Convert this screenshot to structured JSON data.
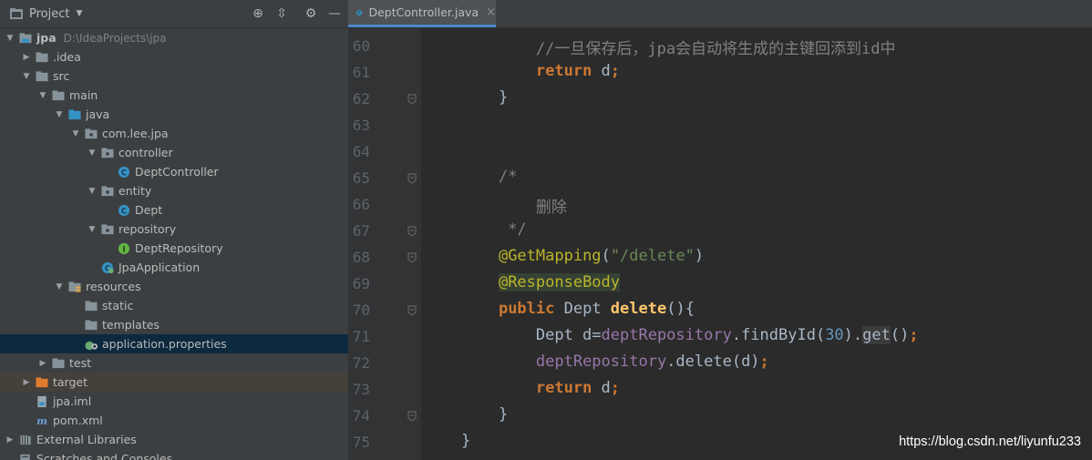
{
  "project_panel": {
    "title": "Project",
    "tree": [
      {
        "label": "jpa",
        "hint": "D:\\IdeaProjects\\jpa",
        "level": 0,
        "arrow": "open",
        "icon": "module-folder-icon",
        "bold": true
      },
      {
        "label": ".idea",
        "level": 1,
        "arrow": "closed",
        "icon": "folder-icon"
      },
      {
        "label": "src",
        "level": 1,
        "arrow": "open",
        "icon": "folder-icon"
      },
      {
        "label": "main",
        "level": 2,
        "arrow": "open",
        "icon": "folder-icon"
      },
      {
        "label": "java",
        "level": 3,
        "arrow": "open",
        "icon": "source-folder-icon"
      },
      {
        "label": "com.lee.jpa",
        "level": 4,
        "arrow": "open",
        "icon": "package-icon"
      },
      {
        "label": "controller",
        "level": 5,
        "arrow": "open",
        "icon": "package-icon"
      },
      {
        "label": "DeptController",
        "level": 6,
        "arrow": "none",
        "icon": "class-icon"
      },
      {
        "label": "entity",
        "level": 5,
        "arrow": "open",
        "icon": "package-icon"
      },
      {
        "label": "Dept",
        "level": 6,
        "arrow": "none",
        "icon": "class-icon"
      },
      {
        "label": "repository",
        "level": 5,
        "arrow": "open",
        "icon": "package-icon"
      },
      {
        "label": "DeptRepository",
        "level": 6,
        "arrow": "none",
        "icon": "interface-icon"
      },
      {
        "label": "JpaApplication",
        "level": 5,
        "arrow": "none",
        "icon": "spring-boot-class-icon"
      },
      {
        "label": "resources",
        "level": 3,
        "arrow": "open",
        "icon": "resources-folder-icon"
      },
      {
        "label": "static",
        "level": 4,
        "arrow": "none",
        "icon": "folder-icon"
      },
      {
        "label": "templates",
        "level": 4,
        "arrow": "none",
        "icon": "folder-icon"
      },
      {
        "label": "application.properties",
        "level": 4,
        "arrow": "none",
        "icon": "spring-properties-icon",
        "selected": true
      },
      {
        "label": "test",
        "level": 2,
        "arrow": "closed",
        "icon": "folder-icon"
      },
      {
        "label": "target",
        "level": 1,
        "arrow": "closed",
        "icon": "excluded-folder-icon",
        "target": true
      },
      {
        "label": "jpa.iml",
        "level": 1,
        "arrow": "none",
        "icon": "iml-file-icon"
      },
      {
        "label": "pom.xml",
        "level": 1,
        "arrow": "none",
        "icon": "maven-icon"
      },
      {
        "label": "External Libraries",
        "level": 0,
        "arrow": "closed",
        "icon": "libraries-icon"
      },
      {
        "label": "Scratches and Consoles",
        "level": 0,
        "arrow": "none",
        "icon": "scratches-icon"
      }
    ]
  },
  "editor": {
    "tab": {
      "label": "DeptController.java",
      "close": "×"
    },
    "lines": [
      {
        "n": "60",
        "tokens": [
          {
            "t": "        //一旦保存后，jpa会自动将生成的主键回添到id中",
            "c": "cm"
          }
        ]
      },
      {
        "n": "61",
        "tokens": [
          {
            "t": "        ",
            "c": ""
          },
          {
            "t": "return",
            "c": "kw"
          },
          {
            "t": " d",
            "c": ""
          },
          {
            "t": ";",
            "c": "kw"
          }
        ]
      },
      {
        "n": "62",
        "fold": true,
        "tokens": [
          {
            "t": "    }",
            "c": ""
          }
        ]
      },
      {
        "n": "63",
        "tokens": []
      },
      {
        "n": "64",
        "tokens": []
      },
      {
        "n": "65",
        "fold": true,
        "tokens": [
          {
            "t": "    /*",
            "c": "cm"
          }
        ]
      },
      {
        "n": "66",
        "tokens": [
          {
            "t": "        删除",
            "c": "cm"
          }
        ]
      },
      {
        "n": "67",
        "fold": true,
        "tokens": [
          {
            "t": "     */",
            "c": "cm"
          }
        ]
      },
      {
        "n": "68",
        "fold": true,
        "tokens": [
          {
            "t": "    ",
            "c": ""
          },
          {
            "t": "@GetMapping",
            "c": "an"
          },
          {
            "t": "(",
            "c": ""
          },
          {
            "t": "\"/delete\"",
            "c": "st"
          },
          {
            "t": ")",
            "c": ""
          }
        ]
      },
      {
        "n": "69",
        "tokens": [
          {
            "t": "    ",
            "c": ""
          },
          {
            "t": "@ResponseBody",
            "c": "an hl"
          }
        ]
      },
      {
        "n": "70",
        "fold": true,
        "tokens": [
          {
            "t": "    ",
            "c": ""
          },
          {
            "t": "public",
            "c": "kw"
          },
          {
            "t": " Dept ",
            "c": ""
          },
          {
            "t": "delete",
            "c": "fn"
          },
          {
            "t": "(){",
            "c": ""
          }
        ]
      },
      {
        "n": "71",
        "tokens": [
          {
            "t": "        Dept d=",
            "c": ""
          },
          {
            "t": "deptRepository",
            "c": "fld"
          },
          {
            "t": ".findById(",
            "c": ""
          },
          {
            "t": "30",
            "c": "num"
          },
          {
            "t": ").",
            "c": ""
          },
          {
            "t": "get",
            "c": "hl2"
          },
          {
            "t": "()",
            "c": ""
          },
          {
            "t": ";",
            "c": "kw"
          }
        ]
      },
      {
        "n": "72",
        "tokens": [
          {
            "t": "        ",
            "c": ""
          },
          {
            "t": "deptRepository",
            "c": "fld"
          },
          {
            "t": ".delete(d)",
            "c": ""
          },
          {
            "t": ";",
            "c": "kw"
          }
        ]
      },
      {
        "n": "73",
        "tokens": [
          {
            "t": "        ",
            "c": ""
          },
          {
            "t": "return",
            "c": "kw"
          },
          {
            "t": " d",
            "c": ""
          },
          {
            "t": ";",
            "c": "kw"
          }
        ]
      },
      {
        "n": "74",
        "fold": true,
        "tokens": [
          {
            "t": "    }",
            "c": ""
          }
        ]
      },
      {
        "n": "75",
        "tokens": [
          {
            "t": "}",
            "c": ""
          }
        ]
      }
    ]
  },
  "watermark": "https://blog.csdn.net/liyunfu233"
}
